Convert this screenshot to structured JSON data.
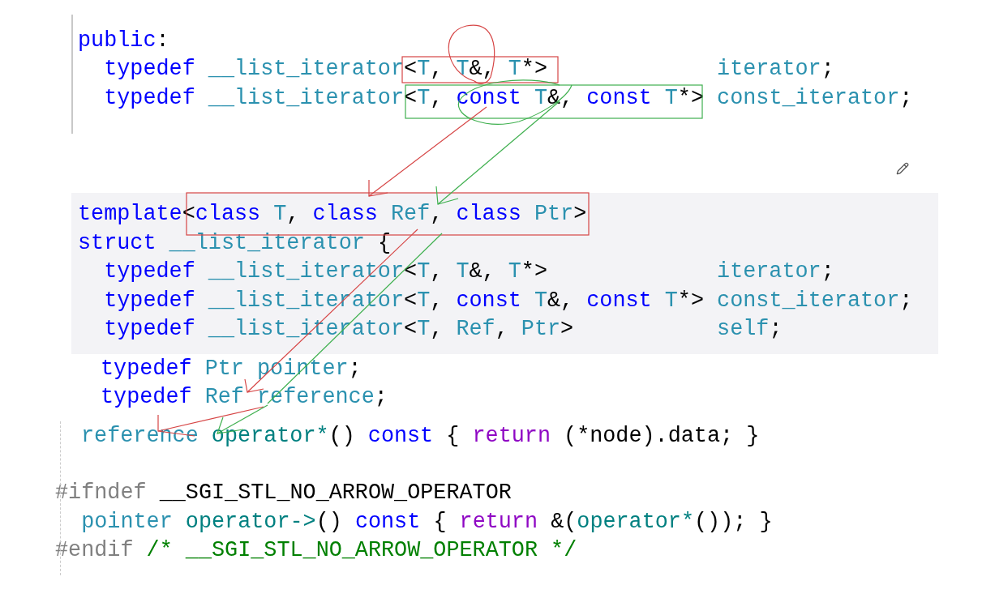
{
  "sections": [
    {
      "lines": [
        [
          {
            "kind": "kw",
            "text": "public"
          },
          {
            "kind": "plain",
            "text": ":"
          }
        ],
        [
          {
            "kind": "kw",
            "text": "  typedef"
          },
          {
            "kind": "type",
            "text": " __list_iterator"
          },
          {
            "kind": "plain",
            "text": "<"
          },
          {
            "kind": "type",
            "text": "T"
          },
          {
            "kind": "plain",
            "text": ","
          },
          {
            "kind": "type",
            "text": " T"
          },
          {
            "kind": "plain",
            "text": "&,"
          },
          {
            "kind": "type",
            "text": " T"
          },
          {
            "kind": "plain",
            "text": "*>"
          },
          {
            "kind": "type",
            "text": "             iterator"
          },
          {
            "kind": "plain",
            "text": ";"
          }
        ],
        [
          {
            "kind": "kw",
            "text": "  typedef"
          },
          {
            "kind": "type",
            "text": " __list_iterator"
          },
          {
            "kind": "plain",
            "text": "<"
          },
          {
            "kind": "type",
            "text": "T"
          },
          {
            "kind": "plain",
            "text": ","
          },
          {
            "kind": "kw",
            "text": " const"
          },
          {
            "kind": "type",
            "text": " T"
          },
          {
            "kind": "plain",
            "text": "&,"
          },
          {
            "kind": "kw",
            "text": " const"
          },
          {
            "kind": "type",
            "text": " T"
          },
          {
            "kind": "plain",
            "text": "*>"
          },
          {
            "kind": "type",
            "text": " const_iterator"
          },
          {
            "kind": "plain",
            "text": ";"
          }
        ]
      ]
    },
    {
      "lines": [
        [
          {
            "kind": "kw",
            "text": "template"
          },
          {
            "kind": "plain",
            "text": "<"
          },
          {
            "kind": "kw",
            "text": "class"
          },
          {
            "kind": "type",
            "text": " T"
          },
          {
            "kind": "plain",
            "text": ","
          },
          {
            "kind": "kw",
            "text": " class"
          },
          {
            "kind": "type",
            "text": " Ref"
          },
          {
            "kind": "plain",
            "text": ","
          },
          {
            "kind": "kw",
            "text": " class"
          },
          {
            "kind": "type",
            "text": " Ptr"
          },
          {
            "kind": "plain",
            "text": ">"
          }
        ],
        [
          {
            "kind": "kw",
            "text": "struct"
          },
          {
            "kind": "type",
            "text": " __list_iterator"
          },
          {
            "kind": "plain",
            "text": " {"
          }
        ],
        [
          {
            "kind": "kw",
            "text": "  typedef"
          },
          {
            "kind": "type",
            "text": " __list_iterator"
          },
          {
            "kind": "plain",
            "text": "<"
          },
          {
            "kind": "type",
            "text": "T"
          },
          {
            "kind": "plain",
            "text": ","
          },
          {
            "kind": "type",
            "text": " T"
          },
          {
            "kind": "plain",
            "text": "&,"
          },
          {
            "kind": "type",
            "text": " T"
          },
          {
            "kind": "plain",
            "text": "*>"
          },
          {
            "kind": "type",
            "text": "             iterator"
          },
          {
            "kind": "plain",
            "text": ";"
          }
        ],
        [
          {
            "kind": "kw",
            "text": "  typedef"
          },
          {
            "kind": "type",
            "text": " __list_iterator"
          },
          {
            "kind": "plain",
            "text": "<"
          },
          {
            "kind": "type",
            "text": "T"
          },
          {
            "kind": "plain",
            "text": ","
          },
          {
            "kind": "kw",
            "text": " const"
          },
          {
            "kind": "type",
            "text": " T"
          },
          {
            "kind": "plain",
            "text": "&,"
          },
          {
            "kind": "kw",
            "text": " const"
          },
          {
            "kind": "type",
            "text": " T"
          },
          {
            "kind": "plain",
            "text": "*>"
          },
          {
            "kind": "type",
            "text": " const_iterator"
          },
          {
            "kind": "plain",
            "text": ";"
          }
        ],
        [
          {
            "kind": "kw",
            "text": "  typedef"
          },
          {
            "kind": "type",
            "text": " __list_iterator"
          },
          {
            "kind": "plain",
            "text": "<"
          },
          {
            "kind": "type",
            "text": "T"
          },
          {
            "kind": "plain",
            "text": ","
          },
          {
            "kind": "type",
            "text": " Ref"
          },
          {
            "kind": "plain",
            "text": ","
          },
          {
            "kind": "type",
            "text": " Ptr"
          },
          {
            "kind": "plain",
            "text": ">"
          },
          {
            "kind": "type",
            "text": "           self"
          },
          {
            "kind": "plain",
            "text": ";"
          }
        ]
      ]
    },
    {
      "lines": [
        [
          {
            "kind": "kw",
            "text": "typedef"
          },
          {
            "kind": "type",
            "text": " Ptr"
          },
          {
            "kind": "type",
            "text": " pointer"
          },
          {
            "kind": "plain",
            "text": ";"
          }
        ],
        [
          {
            "kind": "kw",
            "text": "typedef"
          },
          {
            "kind": "type",
            "text": " Ref"
          },
          {
            "kind": "type",
            "text": " reference"
          },
          {
            "kind": "plain",
            "text": ";"
          }
        ]
      ]
    },
    {
      "lines": [
        [
          {
            "kind": "type",
            "text": "reference"
          },
          {
            "kind": "fn",
            "text": " operator*"
          },
          {
            "kind": "plain",
            "text": "()"
          },
          {
            "kind": "kw",
            "text": " const"
          },
          {
            "kind": "plain",
            "text": " {"
          },
          {
            "kind": "ctrl",
            "text": " return"
          },
          {
            "kind": "plain",
            "text": " (*node).data; }"
          }
        ]
      ]
    },
    {
      "lines": [
        [
          {
            "kind": "pre",
            "text": "#ifndef"
          },
          {
            "kind": "plain",
            "text": " __SGI_STL_NO_ARROW_OPERATOR"
          }
        ],
        [
          {
            "kind": "type",
            "text": "  pointer"
          },
          {
            "kind": "fn",
            "text": " operator->"
          },
          {
            "kind": "plain",
            "text": "()"
          },
          {
            "kind": "kw",
            "text": " const"
          },
          {
            "kind": "plain",
            "text": " {"
          },
          {
            "kind": "ctrl",
            "text": " return"
          },
          {
            "kind": "plain",
            "text": " &("
          },
          {
            "kind": "fn",
            "text": "operator*"
          },
          {
            "kind": "plain",
            "text": "()); }"
          }
        ],
        [
          {
            "kind": "pre",
            "text": "#endif"
          },
          {
            "kind": "comment",
            "text": " /* __SGI_STL_NO_ARROW_OPERATOR */"
          }
        ]
      ]
    }
  ]
}
